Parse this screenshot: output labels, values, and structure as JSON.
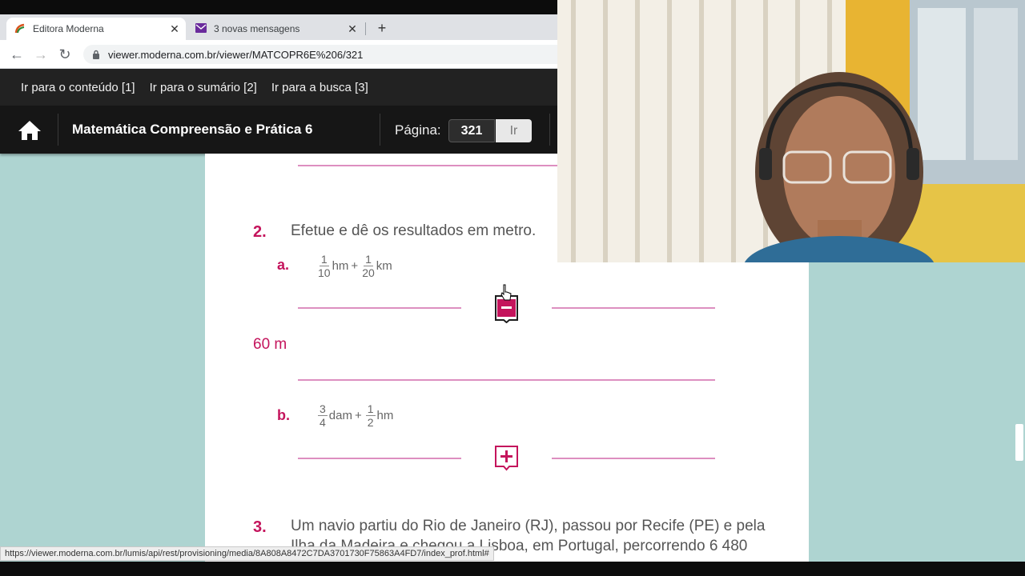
{
  "browser": {
    "tabs": [
      {
        "title": "Editora Moderna",
        "active": true,
        "favicon": "moderna-logo-icon"
      },
      {
        "title": "3 novas mensagens",
        "active": false,
        "favicon": "mail-icon"
      }
    ],
    "url": "viewer.moderna.com.br/viewer/MATCOPR6E%206/321",
    "status_url": "https://viewer.moderna.com.br/lumis/api/rest/provisioning/media/8A808A8472C7DA3701730F75863A4FD7/index_prof.html#"
  },
  "skip_links": [
    "Ir para o conteúdo [1]",
    "Ir para o sumário [2]",
    "Ir para a busca [3]"
  ],
  "header": {
    "book_title": "Matemática Compreensão e Prática 6",
    "page_label": "Página:",
    "page_value": "321",
    "go_label": "Ir"
  },
  "content": {
    "q2": {
      "number": "2.",
      "text": "Efetue e dê os resultados em metro.",
      "a": {
        "letter": "a.",
        "f1": {
          "num": "1",
          "den": "10"
        },
        "u1": "hm",
        "op": "+",
        "f2": {
          "num": "1",
          "den": "20"
        },
        "u2": "km",
        "answer": "60 m"
      },
      "b": {
        "letter": "b.",
        "f1": {
          "num": "3",
          "den": "4"
        },
        "u1": "dam",
        "op": "+",
        "f2": {
          "num": "1",
          "den": "2"
        },
        "u2": "hm"
      }
    },
    "q3": {
      "number": "3.",
      "line1": "Um navio partiu do Rio de Janeiro (RJ), passou por Recife (PE) e pela",
      "line2": "Ilha da Madeira e chegou a Lisboa, em Portugal, percorrendo 6 480"
    }
  },
  "colors": {
    "accent": "#c4145c",
    "rule": "#dd8fc0",
    "background": "#aed4d1",
    "header": "#161616"
  }
}
